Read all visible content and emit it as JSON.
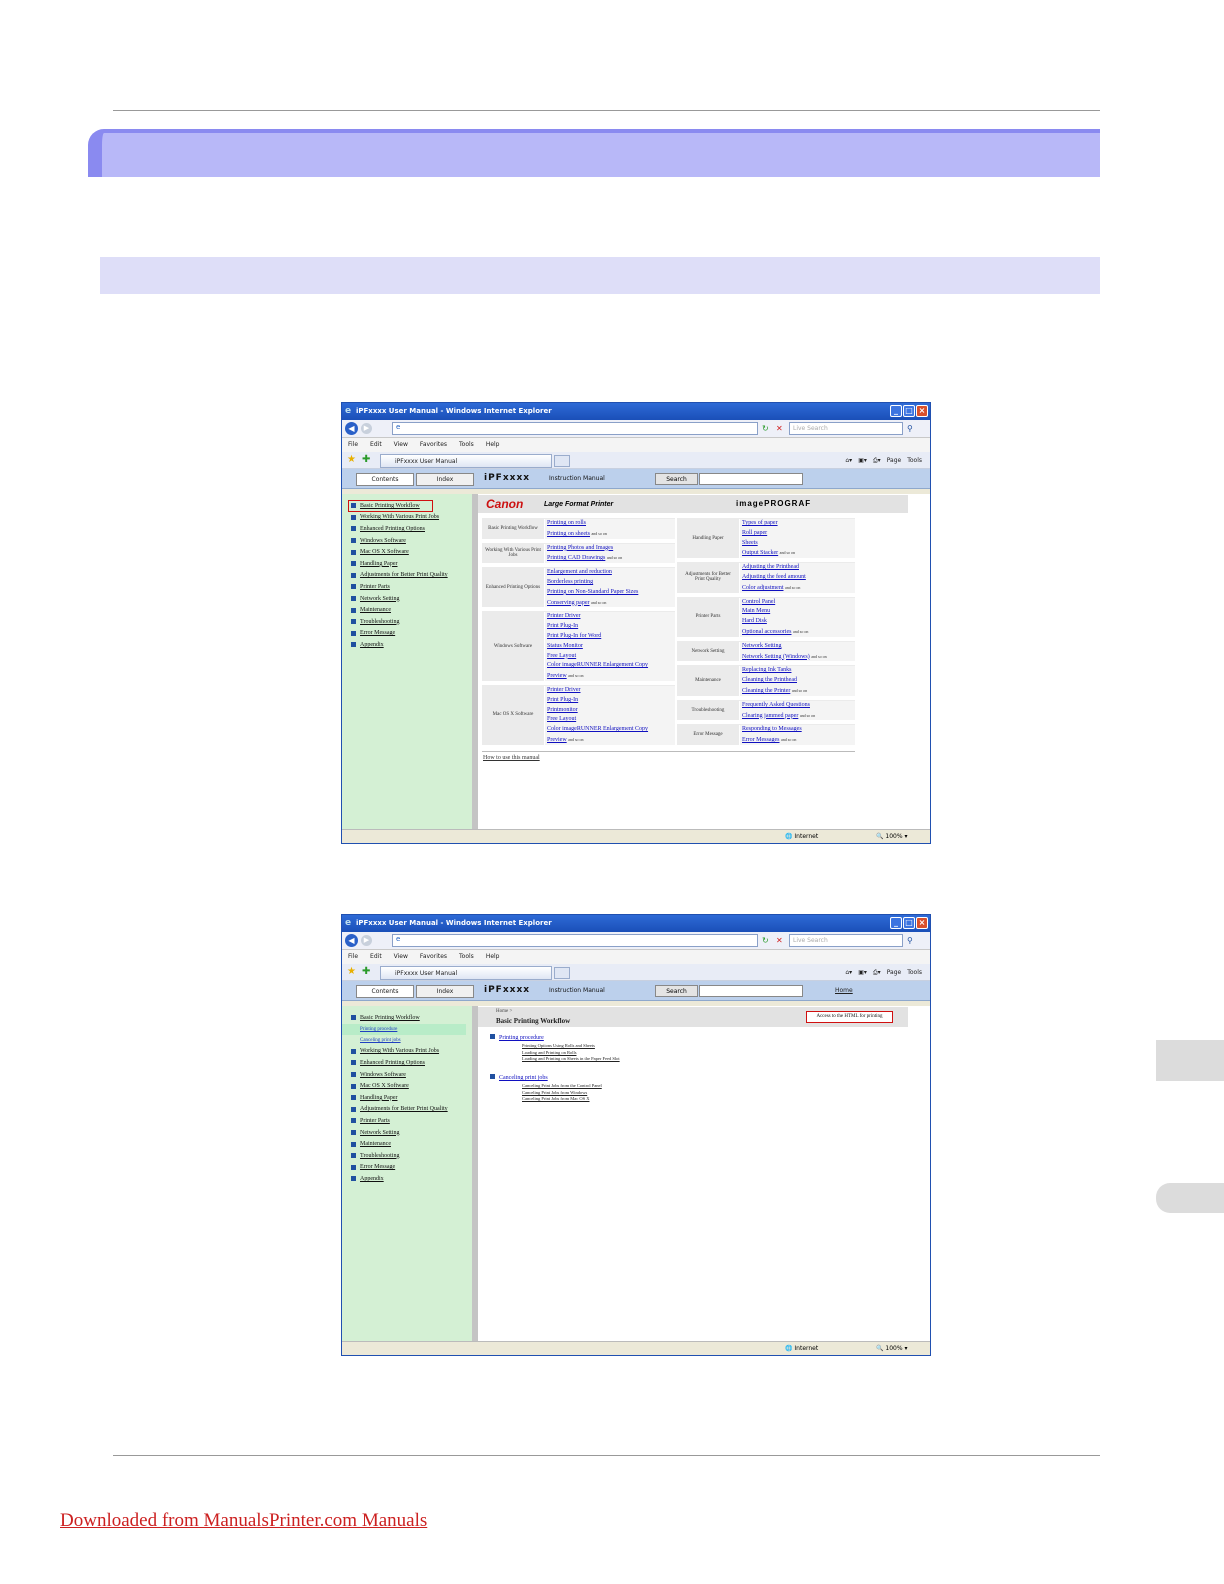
{
  "footer": {
    "download_link": "Downloaded from ManualsPrinter.com Manuals"
  },
  "browser1": {
    "window_title": "iPFxxxx User Manual - Windows Internet Explorer",
    "live_search_placeholder": "Live Search",
    "menu": [
      "File",
      "Edit",
      "View",
      "Favorites",
      "Tools",
      "Help"
    ],
    "tab_title": "iPFxxxx User Manual",
    "toolbar": {
      "page": "Page",
      "tools": "Tools"
    },
    "nav_tabs": {
      "contents": "Contents",
      "index": "Index"
    },
    "brand": "iPFxxxx",
    "doc_type": "Instruction Manual",
    "search_button": "Search",
    "sidebar": [
      "Basic Printing Workflow",
      "Working With Various Print Jobs",
      "Enhanced Printing Options",
      "Windows Software",
      "Mac OS X Software",
      "Handling Paper",
      "Adjustments for Better Print Quality",
      "Printer Parts",
      "Network Setting",
      "Maintenance",
      "Troubleshooting",
      "Error Message",
      "Appendix"
    ],
    "header": {
      "canon": "Canon",
      "lfp": "Large Format Printer",
      "imageprograf": "imagePROGRAF"
    },
    "left_groups": [
      {
        "label": "Basic Printing Workflow",
        "links": [
          "Printing on rolls",
          "Printing on sheets"
        ]
      },
      {
        "label": "Working With Various Print Jobs",
        "links": [
          "Printing Photos and Images",
          "Printing CAD Drawings"
        ]
      },
      {
        "label": "Enhanced Printing Options",
        "links": [
          "Enlargement and reduction",
          "Borderless printing",
          "Printing on Non-Standard Paper Sizes",
          "Conserving paper"
        ]
      },
      {
        "label": "Windows Software",
        "links": [
          "Printer Driver",
          "Print Plug-In",
          "Print Plug-In for Word",
          "Status Monitor",
          "Free Layout",
          "Color imageRUNNER Enlargement Copy",
          "Preview"
        ]
      },
      {
        "label": "Mac OS X Software",
        "links": [
          "Printer Driver",
          "Print Plug-In",
          "Printmonitor",
          "Free Layout",
          "Color imageRUNNER Enlargement Copy",
          "Preview"
        ]
      }
    ],
    "right_groups": [
      {
        "label": "Handling Paper",
        "links": [
          "Types of paper",
          "Roll paper",
          "Sheets",
          "Output Stacker"
        ]
      },
      {
        "label": "Adjustments for Better Print Quality",
        "links": [
          "Adjusting the Printhead",
          "Adjusting the feed amount",
          "Color adjustment"
        ]
      },
      {
        "label": "Printer Parts",
        "links": [
          "Control Panel",
          "Main Menu",
          "Hard Disk",
          "Optional accessories"
        ]
      },
      {
        "label": "Network Setting",
        "links": [
          "Network Setting",
          "Network Setting (Windows)"
        ]
      },
      {
        "label": "Maintenance",
        "links": [
          "Replacing Ink Tanks",
          "Cleaning the Printhead",
          "Cleaning the Printer"
        ]
      },
      {
        "label": "Troubleshooting",
        "links": [
          "Frequently Asked Questions",
          "Clearing jammed paper"
        ]
      },
      {
        "label": "Error Message",
        "links": [
          "Responding to Messages",
          "Error Messages"
        ]
      }
    ],
    "and_so_on": "and so on",
    "howto": "How to use this manual",
    "status": {
      "zone": "Internet",
      "zoom": "100%"
    }
  },
  "browser2": {
    "window_title": "iPFxxxx User Manual - Windows Internet Explorer",
    "live_search_placeholder": "Live Search",
    "menu": [
      "File",
      "Edit",
      "View",
      "Favorites",
      "Tools",
      "Help"
    ],
    "tab_title": "iPFxxxx User Manual",
    "toolbar": {
      "page": "Page",
      "tools": "Tools"
    },
    "nav_tabs": {
      "contents": "Contents",
      "index": "Index"
    },
    "brand": "iPFxxxx",
    "doc_type": "Instruction Manual",
    "search_button": "Search",
    "home_link": "Home",
    "sidebar_top": "Basic Printing Workflow",
    "sidebar_subs": [
      "Printing procedure",
      "Canceling print jobs"
    ],
    "sidebar_rest": [
      "Working With Various Print Jobs",
      "Enhanced Printing Options",
      "Windows Software",
      "Mac OS X Software",
      "Handling Paper",
      "Adjustments for Better Print Quality",
      "Printer Parts",
      "Network Setting",
      "Maintenance",
      "Troubleshooting",
      "Error Message",
      "Appendix"
    ],
    "breadcrumb": "Home >",
    "page_title": "Basic Printing Workflow",
    "access_button": "Access to the HTML for printing",
    "sections": [
      {
        "title": "Printing procedure",
        "items": [
          "Printing Options Using Rolls and Sheets",
          "Loading and Printing on Rolls",
          "Loading and Printing on Sheets in the Paper Feed Slot"
        ]
      },
      {
        "title": "Canceling print jobs",
        "items": [
          "Canceling Print Jobs from the Control Panel",
          "Canceling Print Jobs from Windows",
          "Canceling Print Jobs from Mac OS X"
        ]
      }
    ],
    "status": {
      "zone": "Internet",
      "zoom": "100%"
    }
  }
}
